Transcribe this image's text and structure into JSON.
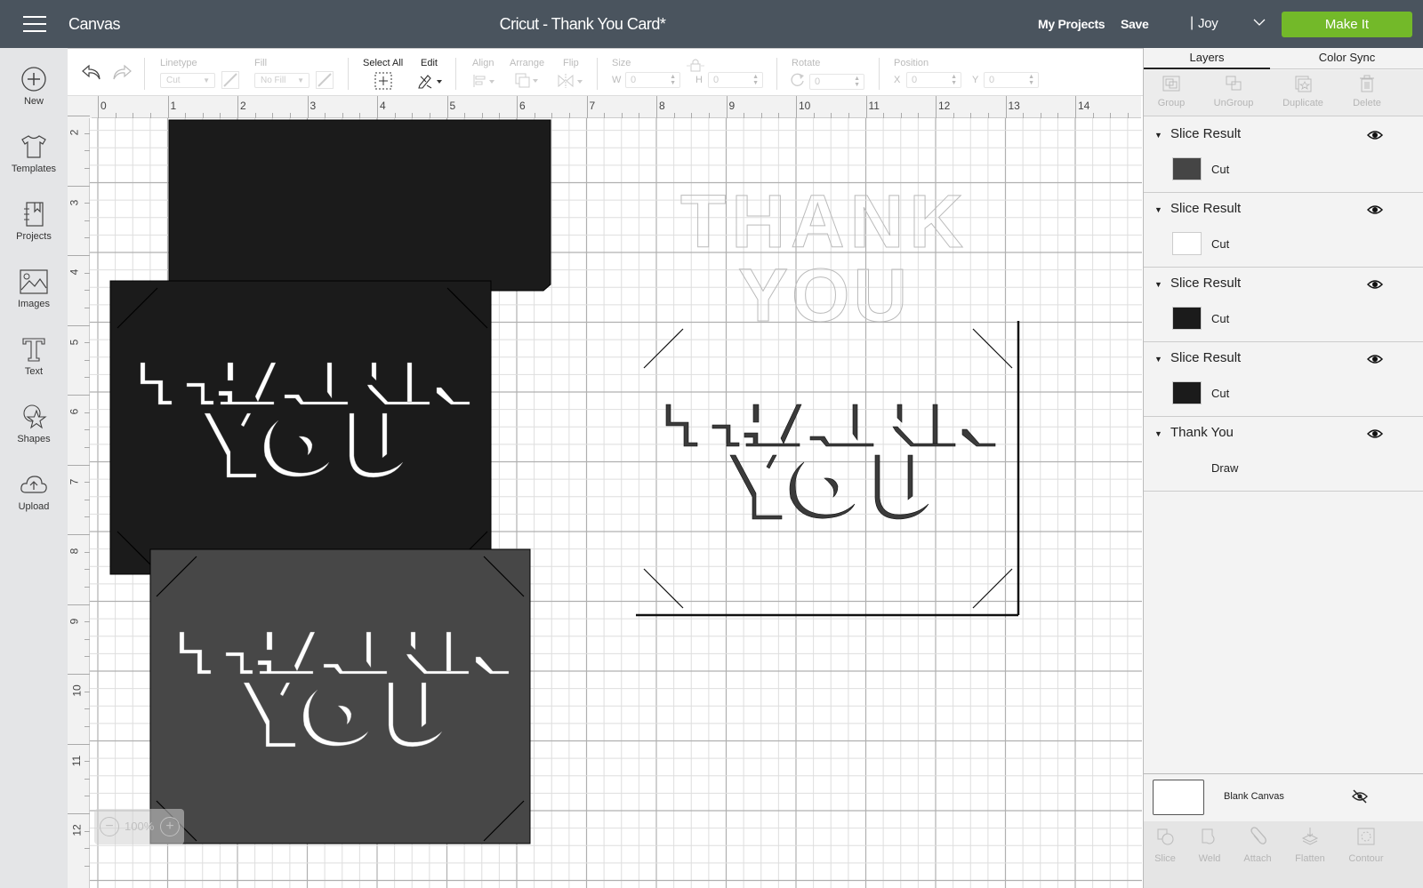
{
  "header": {
    "app_section": "Canvas",
    "document_title": "Cricut - Thank You Card*",
    "my_projects": "My Projects",
    "save": "Save",
    "separator": "|",
    "user": "Joy",
    "make_it": "Make It",
    "accent_color": "#73b929",
    "bar_color": "#4a545e"
  },
  "sidebar": {
    "items": [
      {
        "label": "New",
        "icon": "plus-circle-icon"
      },
      {
        "label": "Templates",
        "icon": "tshirt-icon"
      },
      {
        "label": "Projects",
        "icon": "notebook-icon"
      },
      {
        "label": "Images",
        "icon": "image-icon"
      },
      {
        "label": "Text",
        "icon": "text-icon"
      },
      {
        "label": "Shapes",
        "icon": "shapes-icon"
      },
      {
        "label": "Upload",
        "icon": "cloud-upload-icon"
      }
    ]
  },
  "toolbar": {
    "linetype_label": "Linetype",
    "linetype_value": "Cut",
    "fill_label": "Fill",
    "fill_value": "No Fill",
    "select_all": "Select All",
    "edit": "Edit",
    "align": "Align",
    "arrange": "Arrange",
    "flip": "Flip",
    "size": "Size",
    "w_label": "W",
    "w_value": "0",
    "h_label": "H",
    "h_value": "0",
    "rotate": "Rotate",
    "rotate_value": "0",
    "position": "Position",
    "x_label": "X",
    "x_value": "0",
    "y_label": "Y",
    "y_value": "0"
  },
  "rulers": {
    "top": [
      "0",
      "1",
      "2",
      "3",
      "4",
      "5",
      "6",
      "7",
      "8",
      "9",
      "10",
      "11",
      "12",
      "13",
      "14"
    ],
    "left": [
      "2",
      "3",
      "4",
      "5",
      "6",
      "7",
      "8",
      "9",
      "10",
      "11",
      "12"
    ]
  },
  "canvas": {
    "outline_text_line1": "THANK",
    "outline_text_line2": "YOU",
    "zoom_level": "100%"
  },
  "right_panel": {
    "tabs": [
      {
        "label": "Layers",
        "active": true
      },
      {
        "label": "Color Sync",
        "active": false
      }
    ],
    "actions": [
      "Group",
      "UnGroup",
      "Duplicate",
      "Delete"
    ],
    "layers": [
      {
        "name": "Slice Result",
        "type": "Cut",
        "thumb_color": "#454545",
        "visible": true
      },
      {
        "name": "Slice Result",
        "type": "Cut",
        "thumb_color": "#ffffff",
        "visible": true
      },
      {
        "name": "Slice Result",
        "type": "Cut",
        "thumb_color": "#1b1b1b",
        "visible": true
      },
      {
        "name": "Slice Result",
        "type": "Cut",
        "thumb_color": "#1b1b1b",
        "visible": true
      },
      {
        "name": "Thank You",
        "type": "Draw",
        "thumb_color": "#f3f3f3",
        "visible": true
      }
    ],
    "blank_canvas": {
      "label": "Blank Canvas",
      "visible": false
    },
    "bottom_actions": [
      "Slice",
      "Weld",
      "Attach",
      "Flatten",
      "Contour"
    ]
  }
}
